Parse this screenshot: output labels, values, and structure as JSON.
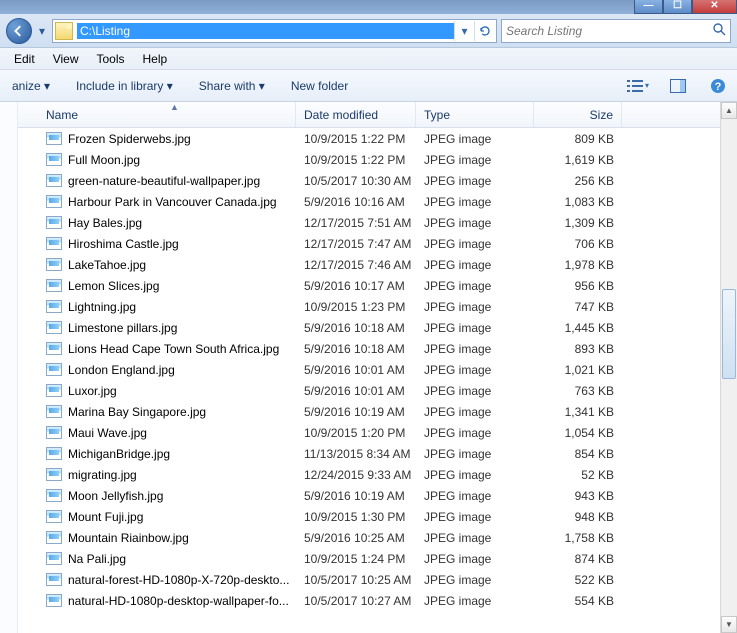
{
  "window": {
    "address_path": "C:\\Listing",
    "search_placeholder": "Search Listing"
  },
  "menubar": {
    "items": [
      "Edit",
      "View",
      "Tools",
      "Help"
    ]
  },
  "toolbar": {
    "organize": "anize ▾",
    "include": "Include in library ▾",
    "share": "Share with ▾",
    "newfolder": "New folder"
  },
  "columns": {
    "name": "Name",
    "date": "Date modified",
    "type": "Type",
    "size": "Size"
  },
  "files": [
    {
      "name": "Frozen Spiderwebs.jpg",
      "date": "10/9/2015 1:22 PM",
      "type": "JPEG image",
      "size": "809 KB"
    },
    {
      "name": "Full Moon.jpg",
      "date": "10/9/2015 1:22 PM",
      "type": "JPEG image",
      "size": "1,619 KB"
    },
    {
      "name": "green-nature-beautiful-wallpaper.jpg",
      "date": "10/5/2017 10:30 AM",
      "type": "JPEG image",
      "size": "256 KB"
    },
    {
      "name": "Harbour Park in Vancouver Canada.jpg",
      "date": "5/9/2016 10:16 AM",
      "type": "JPEG image",
      "size": "1,083 KB"
    },
    {
      "name": "Hay Bales.jpg",
      "date": "12/17/2015 7:51 AM",
      "type": "JPEG image",
      "size": "1,309 KB"
    },
    {
      "name": "Hiroshima Castle.jpg",
      "date": "12/17/2015 7:47 AM",
      "type": "JPEG image",
      "size": "706 KB"
    },
    {
      "name": "LakeTahoe.jpg",
      "date": "12/17/2015 7:46 AM",
      "type": "JPEG image",
      "size": "1,978 KB"
    },
    {
      "name": "Lemon Slices.jpg",
      "date": "5/9/2016 10:17 AM",
      "type": "JPEG image",
      "size": "956 KB"
    },
    {
      "name": "Lightning.jpg",
      "date": "10/9/2015 1:23 PM",
      "type": "JPEG image",
      "size": "747 KB"
    },
    {
      "name": "Limestone pillars.jpg",
      "date": "5/9/2016 10:18 AM",
      "type": "JPEG image",
      "size": "1,445 KB"
    },
    {
      "name": "Lions Head Cape Town South Africa.jpg",
      "date": "5/9/2016 10:18 AM",
      "type": "JPEG image",
      "size": "893 KB"
    },
    {
      "name": "London England.jpg",
      "date": "5/9/2016 10:01 AM",
      "type": "JPEG image",
      "size": "1,021 KB"
    },
    {
      "name": "Luxor.jpg",
      "date": "5/9/2016 10:01 AM",
      "type": "JPEG image",
      "size": "763 KB"
    },
    {
      "name": "Marina  Bay Singapore.jpg",
      "date": "5/9/2016 10:19 AM",
      "type": "JPEG image",
      "size": "1,341 KB"
    },
    {
      "name": "Maui Wave.jpg",
      "date": "10/9/2015 1:20 PM",
      "type": "JPEG image",
      "size": "1,054 KB"
    },
    {
      "name": "MichiganBridge.jpg",
      "date": "11/13/2015 8:34 AM",
      "type": "JPEG image",
      "size": "854 KB"
    },
    {
      "name": "migrating.jpg",
      "date": "12/24/2015 9:33 AM",
      "type": "JPEG image",
      "size": "52 KB"
    },
    {
      "name": "Moon Jellyfish.jpg",
      "date": "5/9/2016 10:19 AM",
      "type": "JPEG image",
      "size": "943 KB"
    },
    {
      "name": "Mount Fuji.jpg",
      "date": "10/9/2015 1:30 PM",
      "type": "JPEG image",
      "size": "948 KB"
    },
    {
      "name": "Mountain Riainbow.jpg",
      "date": "5/9/2016 10:25 AM",
      "type": "JPEG image",
      "size": "1,758 KB"
    },
    {
      "name": "Na Pali.jpg",
      "date": "10/9/2015 1:24 PM",
      "type": "JPEG image",
      "size": "874 KB"
    },
    {
      "name": "natural-forest-HD-1080p-X-720p-deskto...",
      "date": "10/5/2017 10:25 AM",
      "type": "JPEG image",
      "size": "522 KB"
    },
    {
      "name": "natural-HD-1080p-desktop-wallpaper-fo...",
      "date": "10/5/2017 10:27 AM",
      "type": "JPEG image",
      "size": "554 KB"
    }
  ]
}
